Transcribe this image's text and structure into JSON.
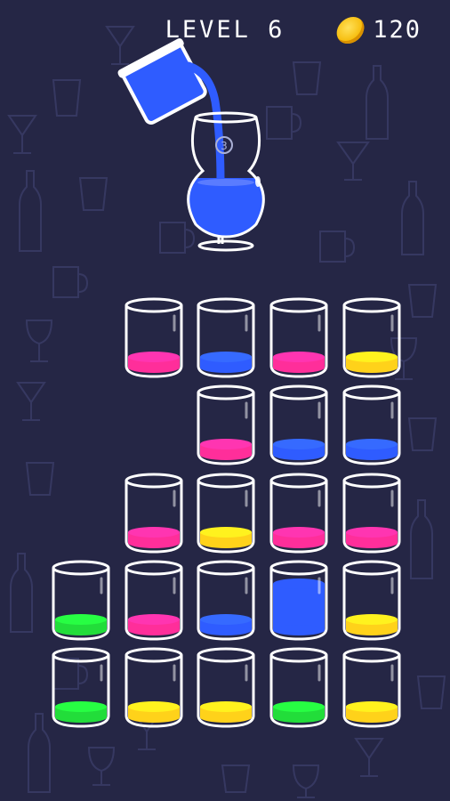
{
  "hud": {
    "level_text": "LEVEL 6",
    "coins": "120",
    "coin_icon": "gold-coin-icon"
  },
  "pour_glass": {
    "badge": "3",
    "liquid_color": "#2f5cff",
    "pouring_cup_color": "#2f5cff"
  },
  "colors": {
    "pink": "#ff2e9a",
    "blue": "#2f5cff",
    "yellow": "#ffd21a",
    "green": "#22dd3a",
    "background": "#252645"
  },
  "grid": {
    "rows": [
      [
        "empty",
        "pink",
        "blue",
        "pink",
        "yellow"
      ],
      [
        "empty",
        "empty",
        "pink",
        "blue",
        "blue"
      ],
      [
        "empty",
        "pink",
        "yellow",
        "pink",
        "pink"
      ],
      [
        "green",
        "pink",
        "blue",
        "blue-tall",
        "yellow"
      ],
      [
        "green",
        "yellow",
        "yellow",
        "green",
        "yellow"
      ]
    ]
  }
}
